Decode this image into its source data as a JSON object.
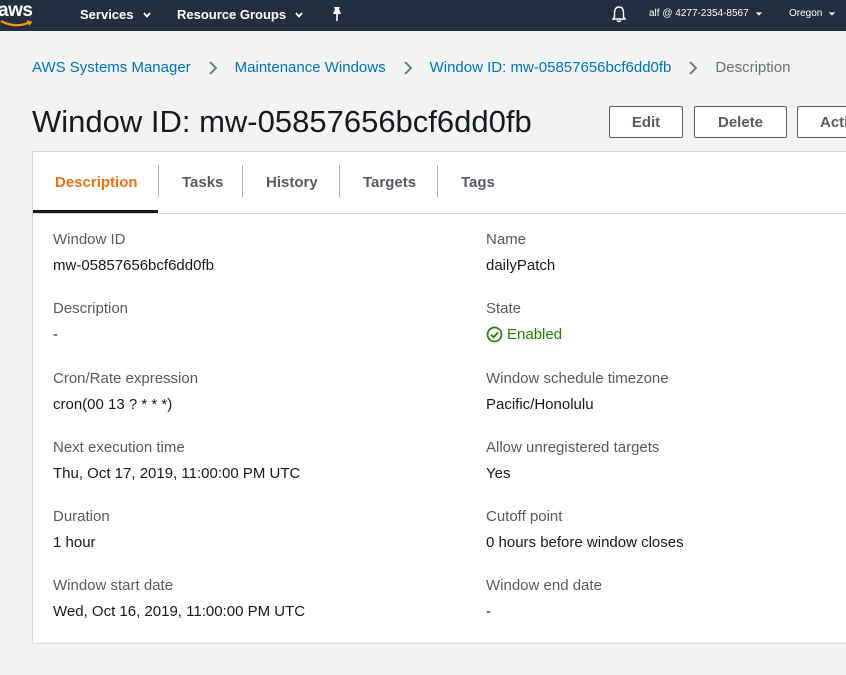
{
  "nav": {
    "logo": "aws",
    "services": "Services",
    "resource_groups": "Resource Groups",
    "account": "alf @ 4277-2354-8567",
    "region": "Oregon"
  },
  "breadcrumb": {
    "items": [
      "AWS Systems Manager",
      "Maintenance Windows",
      "Window ID: mw-05857656bcf6dd0fb"
    ],
    "current": "Description"
  },
  "header": {
    "title": "Window ID: mw-05857656bcf6dd0fb",
    "edit": "Edit",
    "delete": "Delete",
    "actions": "Acti"
  },
  "tabs": [
    "Description",
    "Tasks",
    "History",
    "Targets",
    "Tags"
  ],
  "fields": {
    "left": [
      {
        "label": "Window ID",
        "value": "mw-05857656bcf6dd0fb"
      },
      {
        "label": "Description",
        "value": "-"
      },
      {
        "label": "Cron/Rate expression",
        "value": "cron(00 13 ? * * *)"
      },
      {
        "label": "Next execution time",
        "value": "Thu, Oct 17, 2019, 11:00:00 PM UTC"
      },
      {
        "label": "Duration",
        "value": "1 hour"
      },
      {
        "label": "Window start date",
        "value": "Wed, Oct 16, 2019, 11:00:00 PM UTC"
      }
    ],
    "right": [
      {
        "label": "Name",
        "value": "dailyPatch"
      },
      {
        "label": "State",
        "value": "Enabled"
      },
      {
        "label": "Window schedule timezone",
        "value": "Pacific/Honolulu"
      },
      {
        "label": "Allow unregistered targets",
        "value": "Yes"
      },
      {
        "label": "Cutoff point",
        "value": "0 hours before window closes"
      },
      {
        "label": "Window end date",
        "value": "-"
      }
    ]
  },
  "colors": {
    "nav_bg": "#232f3e",
    "link": "#0073bb",
    "active_tab": "#ec7211",
    "enabled": "#1d8102",
    "page_bg": "#f2f3f3"
  }
}
